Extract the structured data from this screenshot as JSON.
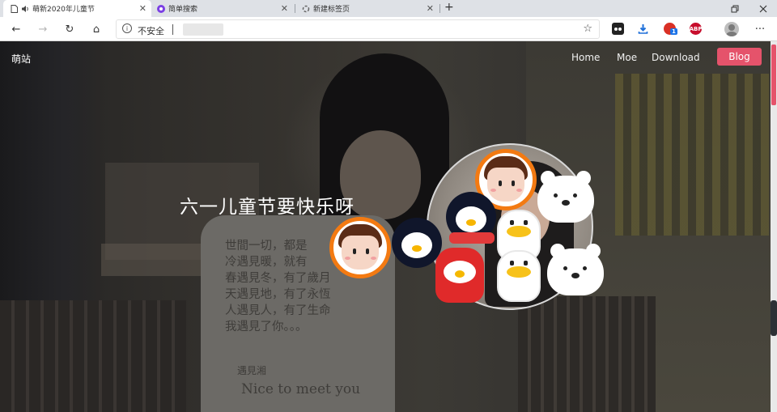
{
  "tabs": [
    {
      "title": "萌新2020年儿童节",
      "active": true,
      "favicon": "page-icon",
      "audio": "speaker-icon"
    },
    {
      "title": "简单搜索",
      "active": false,
      "favicon": "search-app-icon"
    },
    {
      "title": "新建标签页",
      "active": false,
      "favicon": "loading-icon"
    }
  ],
  "window_controls": [
    "restore-icon",
    "close-icon"
  ],
  "toolbar": {
    "back_icon": "←",
    "forward_icon": "→",
    "refresh_icon": "↻",
    "home_icon": "⌂",
    "info_icon": "i",
    "security_label": "不安全",
    "star_icon": "☆",
    "menu_icon": "···"
  },
  "extensions": [
    {
      "name": "cat-extension",
      "label": "",
      "color": "#222222"
    },
    {
      "name": "download-extension",
      "label": "",
      "color": "#1e6fd9"
    },
    {
      "name": "badge-extension",
      "label": "1",
      "color": "#d93025"
    },
    {
      "name": "adblock-extension",
      "label": "ABP",
      "color": "#c70d2c"
    }
  ],
  "site": {
    "brand": "萌站",
    "nav": [
      "Home",
      "Moe",
      "Download"
    ],
    "blog_label": "Blog",
    "headline": "六一儿童节要快乐呀",
    "accent_color": "#e5536b",
    "pillow_text": "世間一切，都是\n冷遇見暖，就有\n春遇見冬，有了歲月\n天遇見地，有了永恆\n人遇見人，有了生命\n我遇見了你。。。",
    "pillow_sig": "遇見湘",
    "pillow_eng": "Nice to meet you"
  }
}
